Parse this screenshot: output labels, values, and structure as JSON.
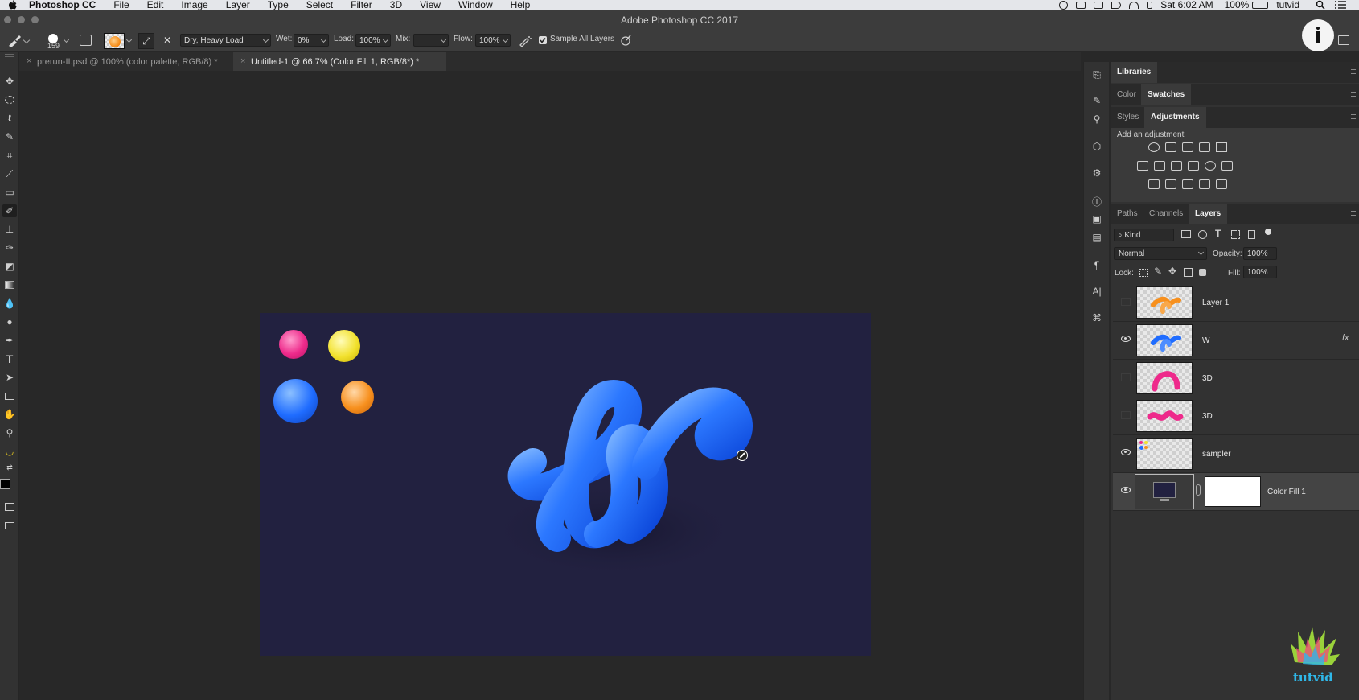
{
  "menubar": {
    "app": "Photoshop CC",
    "items": [
      "File",
      "Edit",
      "Image",
      "Layer",
      "Type",
      "Select",
      "Filter",
      "3D",
      "View",
      "Window",
      "Help"
    ],
    "time": "Sat 6:02 AM",
    "battery": "100%",
    "user": "tutvid"
  },
  "window": {
    "title": "Adobe Photoshop CC 2017"
  },
  "options": {
    "brush_size": "159",
    "mode": "Dry, Heavy Load",
    "wet_label": "Wet:",
    "wet_value": "0%",
    "load_label": "Load:",
    "load_value": "100%",
    "mix_label": "Mix:",
    "mix_value": "",
    "flow_label": "Flow:",
    "flow_value": "100%",
    "sample_all_layers": "Sample All Layers"
  },
  "tabs": [
    {
      "label": "prerun-II.psd @ 100% (color palette, RGB/8) *",
      "active": false
    },
    {
      "label": "Untitled-1 @ 66.7% (Color Fill 1, RGB/8*) *",
      "active": true
    }
  ],
  "panels": {
    "libraries": "Libraries",
    "color_tab": "Color",
    "swatches_tab": "Swatches",
    "styles_tab": "Styles",
    "adjustments_tab": "Adjustments",
    "add_adjustment": "Add an adjustment",
    "paths_tab": "Paths",
    "channels_tab": "Channels",
    "layers_tab": "Layers"
  },
  "layers_panel": {
    "filter_kind": "Kind",
    "blend_mode": "Normal",
    "opacity_label": "Opacity:",
    "opacity_value": "100%",
    "lock_label": "Lock:",
    "fill_label": "Fill:",
    "fill_value": "100%",
    "fx": "fx",
    "layers": [
      {
        "name": "Layer 1",
        "visible": false
      },
      {
        "name": "W",
        "visible": true
      },
      {
        "name": "3D",
        "visible": false
      },
      {
        "name": "3D",
        "visible": false
      },
      {
        "name": "sampler",
        "visible": true
      },
      {
        "name": "Color Fill 1",
        "visible": true,
        "selected": true
      }
    ]
  },
  "colors": {
    "artboard_bg": "#222140",
    "blue_tube": "#1f6cff",
    "pink": "#ee2a8b",
    "yellow": "#f2e12e",
    "orange": "#f7901e"
  },
  "watermark": "tutvid"
}
